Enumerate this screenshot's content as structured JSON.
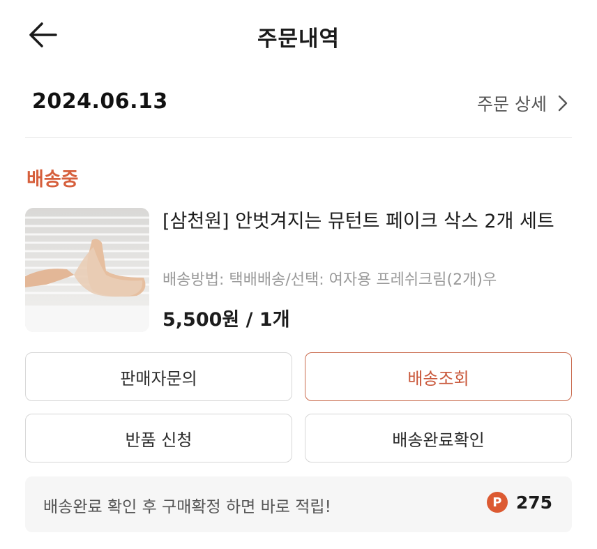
{
  "header": {
    "title": "주문내역",
    "back_icon": "arrow-left-icon"
  },
  "order": {
    "date": "2024.06.13",
    "detail_label": "주문 상세",
    "detail_icon": "chevron-right-icon",
    "status": "배송중",
    "status_color": "#d65f3c"
  },
  "product": {
    "name": "[삼천원] 안벗겨지는 뮤턴트 페이크 삭스 2개 세트",
    "option": "배송방법: 택배배송/선택: 여자용 프레쉬크림(2개)우",
    "price": "5,500원 / 1개"
  },
  "actions": {
    "seller_inquiry": "판매자문의",
    "track_delivery": "배송조회",
    "return_request": "반품 신청",
    "confirm_delivery": "배송완료확인"
  },
  "point_banner": {
    "message": "배송완료 확인 후 구매확정 하면 바로 적립!",
    "icon_letter": "P",
    "amount": "275",
    "icon_color": "#dc5a32"
  }
}
